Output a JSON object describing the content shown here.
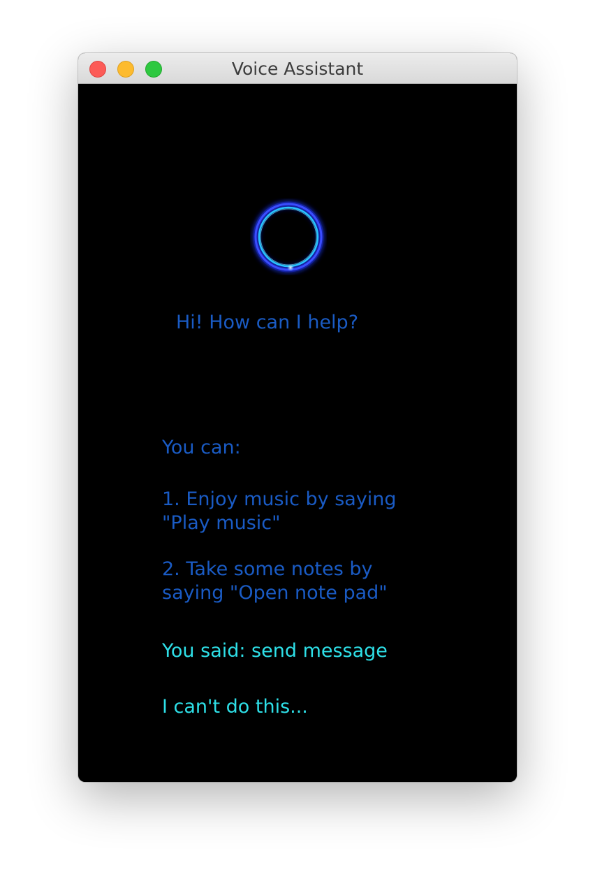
{
  "window": {
    "title": "Voice Assistant"
  },
  "assistant": {
    "greeting": "Hi! How can I help?",
    "help_heading": "You can:",
    "help_items": [
      {
        "line1": "1. Enjoy music by saying",
        "line2": "\"Play music\""
      },
      {
        "line1": "2. Take some notes by",
        "line2": "saying \"Open note pad\""
      }
    ],
    "user_said": "You said: send message",
    "response": "I can't do this..."
  },
  "colors": {
    "background": "#000000",
    "prompt_text": "#1a5bc4",
    "conversation_text": "#2ee0e8",
    "orb_ring": "#3a7cff"
  },
  "icons": {
    "listening_orb": "glowing-ring-icon"
  }
}
